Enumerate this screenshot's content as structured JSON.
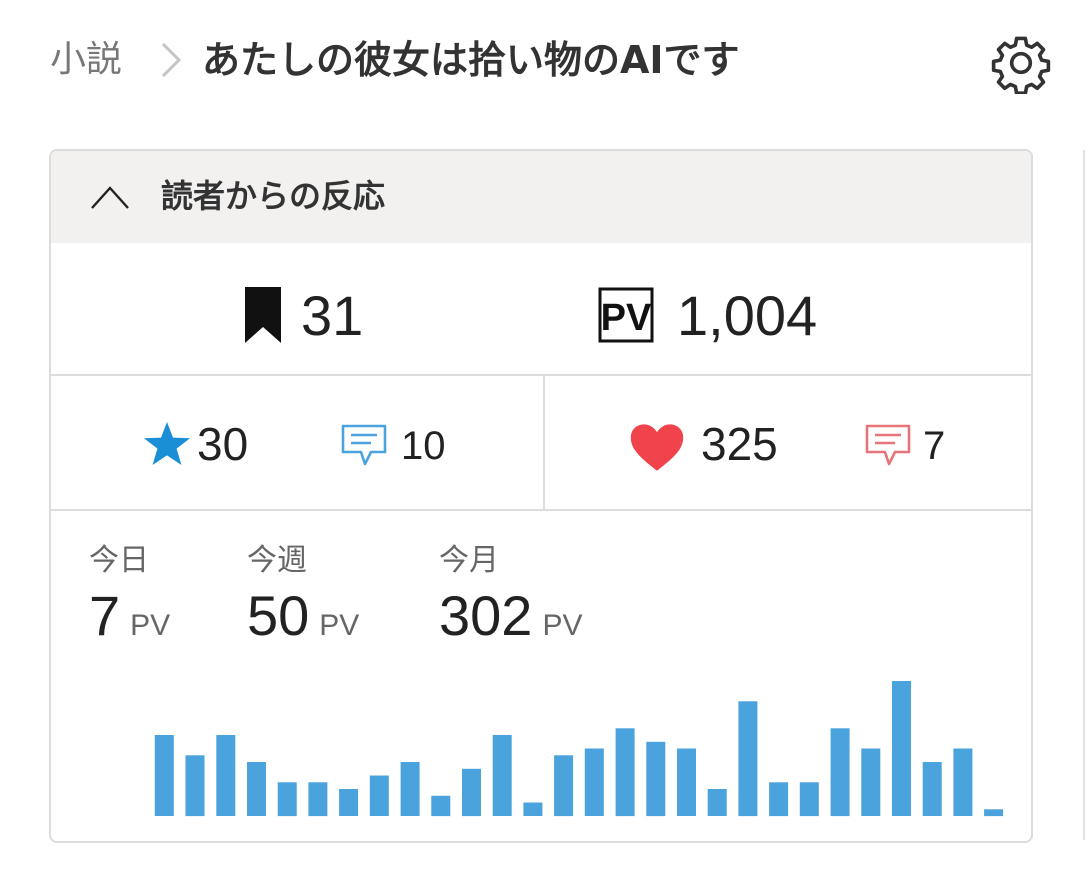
{
  "breadcrumb": {
    "root": "小説",
    "title": "あたしの彼女は拾い物のAIです"
  },
  "icons": {
    "settings": "gear-icon",
    "separator": "chevron-right-icon",
    "collapse": "chevron-up-icon",
    "bookmark": "bookmark-icon",
    "pv": "pv-icon",
    "star": "star-icon",
    "review": "comment-icon",
    "heart": "heart-icon",
    "cheer": "comment-icon"
  },
  "colors": {
    "accent_blue": "#1a8fd6",
    "chart_blue": "#4ba3dd",
    "heart_red": "#f0434b",
    "comment_red": "#e8747a",
    "header_bg": "#f2f1f0"
  },
  "panel": {
    "title": "読者からの反応"
  },
  "reactions": {
    "bookmarks": "31",
    "page_views": "1,004",
    "stars": "30",
    "reviews": "10",
    "hearts": "325",
    "cheer_comments": "7"
  },
  "stats": [
    {
      "label": "今日",
      "value": "7",
      "unit": "PV"
    },
    {
      "label": "今週",
      "value": "50",
      "unit": "PV"
    },
    {
      "label": "今月",
      "value": "302",
      "unit": "PV"
    }
  ],
  "chart_data": {
    "type": "bar",
    "values": [
      12,
      9,
      12,
      8,
      5,
      5,
      4,
      6,
      8,
      3,
      7,
      12,
      2,
      9,
      10,
      13,
      11,
      10,
      4,
      17,
      5,
      5,
      13,
      10,
      20,
      8,
      10,
      1
    ],
    "color": "#4ba3dd",
    "title": "",
    "xlabel": "",
    "ylabel": ""
  }
}
